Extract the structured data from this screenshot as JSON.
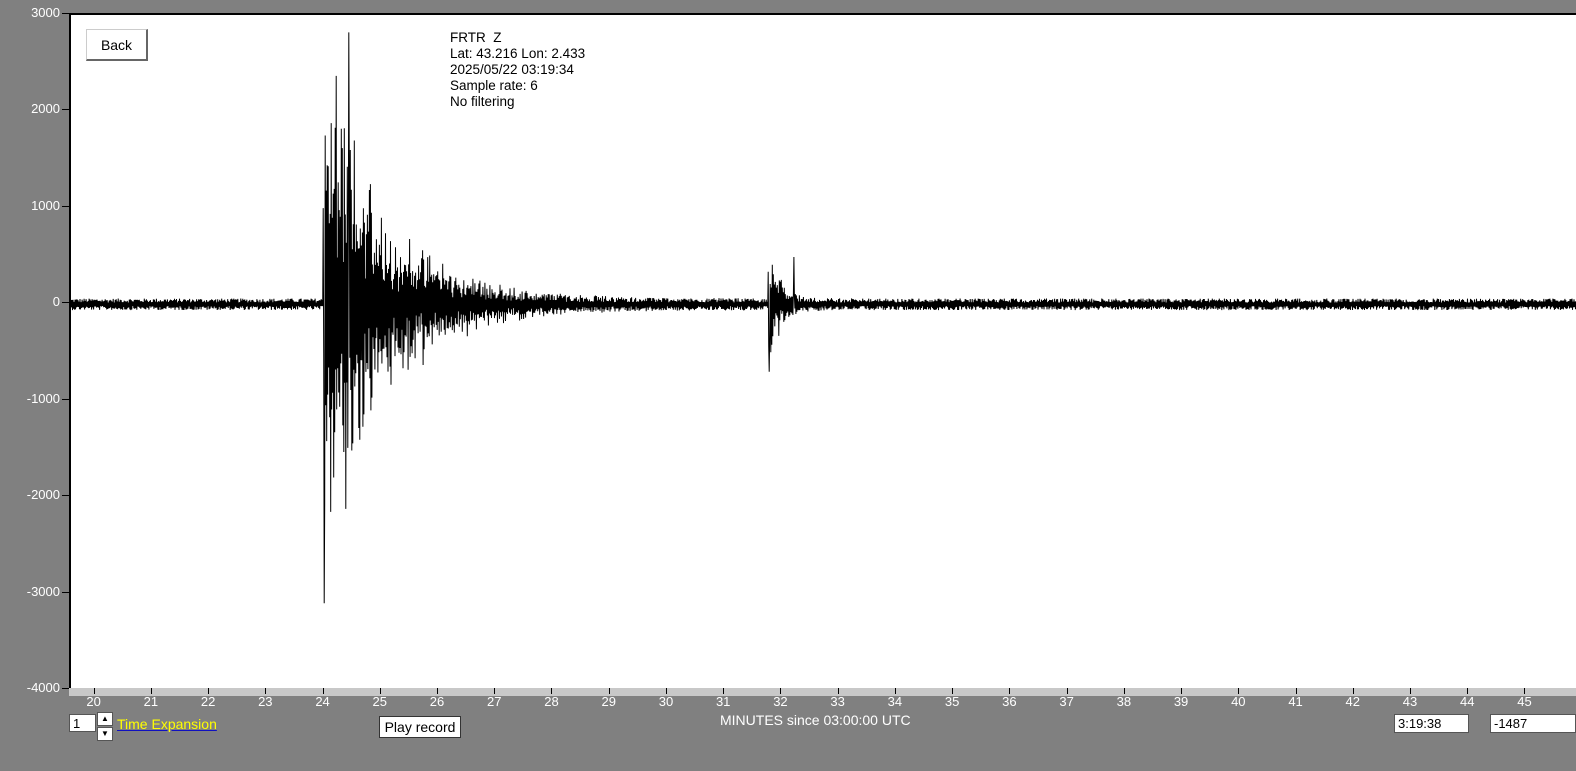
{
  "back_label": "Back",
  "info": {
    "station": "FRTR  Z",
    "location": "Lat: 43.216 Lon: 2.433",
    "datetime": "2025/05/22 03:19:34",
    "sample_rate": "Sample rate: 6",
    "filter": "No filtering"
  },
  "controls": {
    "expansion_value": "1",
    "expansion_label": "Time Expansion",
    "play_label": "Play record",
    "time_readout": "3:19:38",
    "value_readout": "-1487"
  },
  "colors": {
    "background": "#808080",
    "plot_bg": "#ffffff",
    "trace": "#000000",
    "label_highlight": "#ffff00"
  },
  "chart_data": {
    "type": "line",
    "xlabel": "MINUTES since 03:00:00 UTC",
    "ylabel": "",
    "title": "",
    "xlim": [
      19.57,
      45.9
    ],
    "ylim": [
      -4000,
      3000
    ],
    "x_ticks": [
      20,
      21,
      22,
      23,
      24,
      25,
      26,
      27,
      28,
      29,
      30,
      31,
      32,
      33,
      34,
      35,
      36,
      37,
      38,
      39,
      40,
      41,
      42,
      43,
      44,
      45
    ],
    "y_ticks": [
      3000,
      2000,
      1000,
      0,
      -1000,
      -2000,
      -3000,
      -4000
    ],
    "grid": false,
    "legend": "none",
    "events": [
      {
        "onset_min": 23.97,
        "peak_max": 2820,
        "peak_min": -3100,
        "decay_min": 3.2
      },
      {
        "onset_min": 31.75,
        "peak_max": 490,
        "peak_min": -700,
        "decay_min": 0.6
      }
    ],
    "noise_amplitude": 60
  }
}
